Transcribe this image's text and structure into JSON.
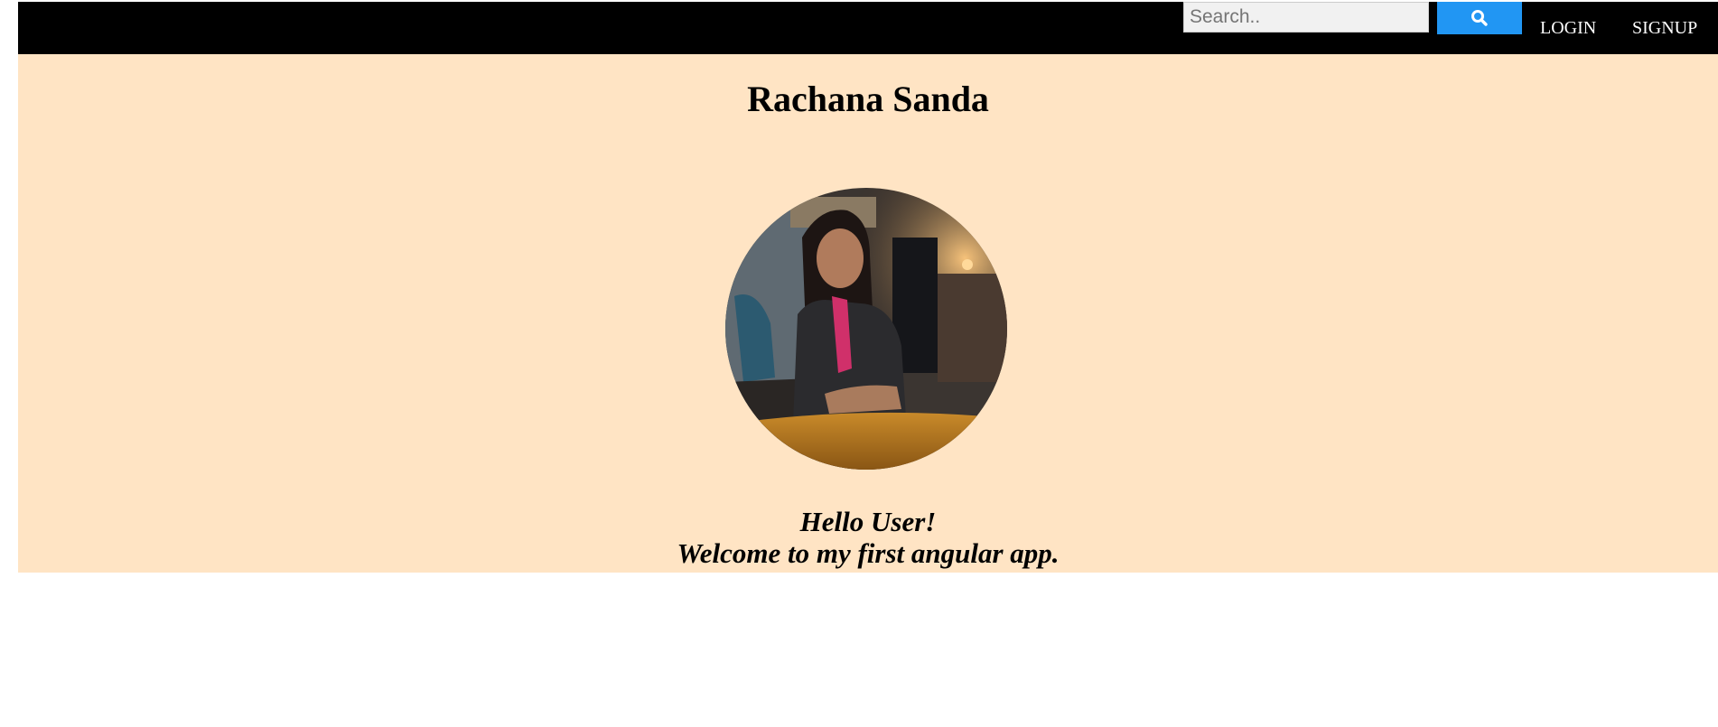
{
  "header": {
    "search": {
      "placeholder": "Search..",
      "value": ""
    },
    "search_icon": "search-icon",
    "links": [
      {
        "label": "LOGIN"
      },
      {
        "label": "SIGNUP"
      }
    ]
  },
  "main": {
    "title": "Rachana Sanda",
    "avatar_alt": "profile-photo",
    "greeting_line1": "Hello User!",
    "greeting_line2": "Welcome to my first angular app."
  },
  "colors": {
    "navbar": "#000000",
    "banner": "#ffe4c4",
    "search_button": "#2196F3",
    "nav_text": "#ffffff"
  }
}
